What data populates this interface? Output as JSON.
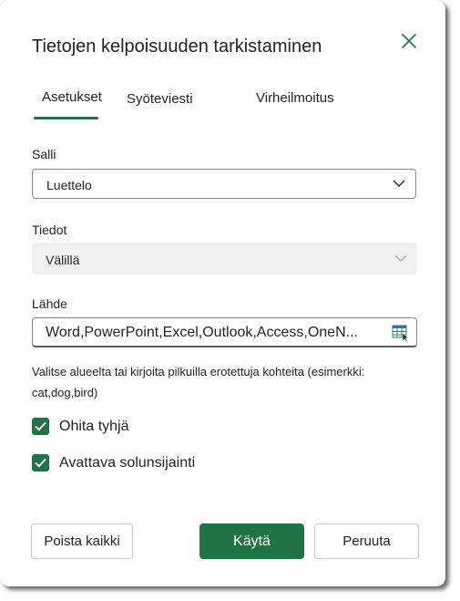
{
  "dialog": {
    "title": "Tietojen kelpoisuuden tarkistaminen",
    "close_icon": "close-icon"
  },
  "tabs": [
    {
      "label": "Asetukset",
      "selected": true
    },
    {
      "label": "Syöteviesti",
      "selected": false
    },
    {
      "label": "Virheilmoitus",
      "selected": false
    }
  ],
  "allow": {
    "label": "Salli",
    "value": "Luettelo"
  },
  "data": {
    "label": "Tiedot",
    "value": "Välillä",
    "disabled": true
  },
  "source": {
    "label": "Lähde",
    "value": "Word,PowerPoint,Excel,Outlook,Access,OneN...",
    "icon": "range-select-icon"
  },
  "hint": "Valitse alueelta tai kirjoita pilkuilla erotettuja kohteita (esimerkki: cat,dog,bird)",
  "checkboxes": [
    {
      "label": "Ohita tyhjä",
      "checked": true
    },
    {
      "label": "Avattava solunsijainti",
      "checked": true
    }
  ],
  "buttons": {
    "clear_all": "Poista kaikki",
    "apply": "Käytä",
    "cancel": "Peruuta"
  },
  "colors": {
    "accent": "#217346",
    "disabled_bg": "#f0f0f0"
  }
}
